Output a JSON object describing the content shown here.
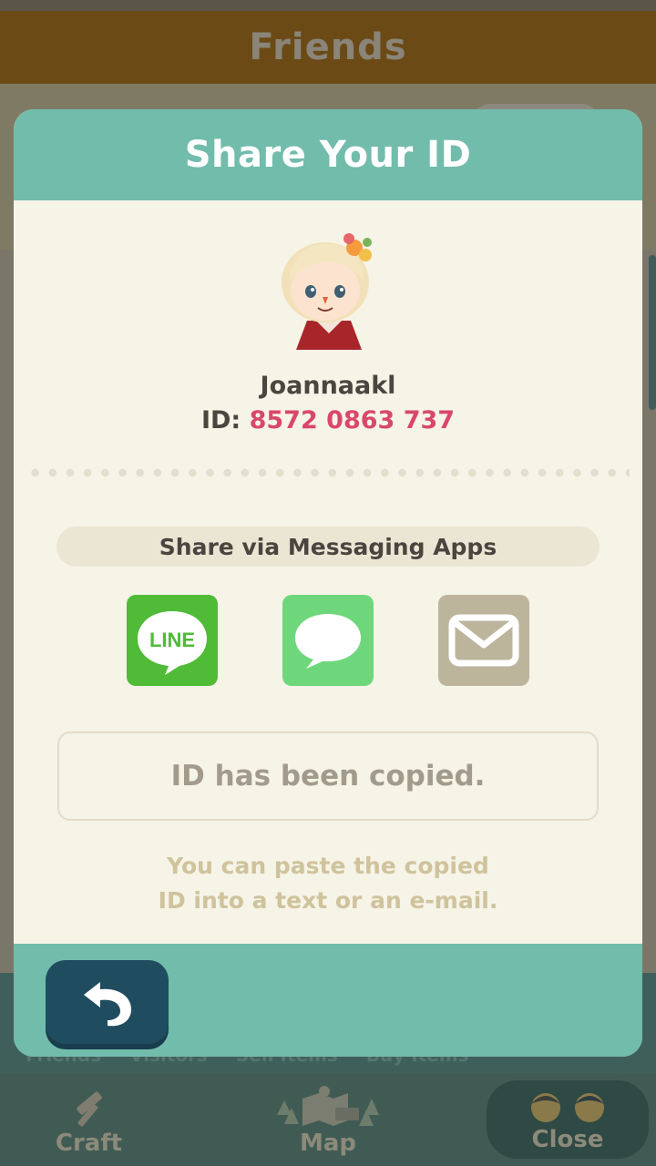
{
  "background": {
    "title": "Friends",
    "tab_labels": [
      "Friends",
      "Visitors",
      "Sell Items",
      "Buy Items"
    ]
  },
  "bottom_nav": {
    "items": [
      {
        "label": "Craft",
        "icon": "hammer-icon"
      },
      {
        "label": "Map",
        "icon": "map-icon"
      },
      {
        "label": "Close",
        "icon": "friends-faces-icon"
      }
    ]
  },
  "modal": {
    "title": "Share Your ID",
    "avatar": "player-avatar",
    "username": "Joannaakl",
    "id_label": "ID:",
    "id_value": "8572 0863 737",
    "share_heading": "Share via Messaging Apps",
    "share_apps": [
      {
        "label": "LINE",
        "icon": "line-icon",
        "color": "#4fbb37"
      },
      {
        "label": "",
        "icon": "speech-bubble-icon",
        "color": "#6fd77b"
      },
      {
        "label": "",
        "icon": "mail-icon",
        "color": "#bcb59c"
      }
    ],
    "copied_message": "ID has been copied.",
    "hint_line1": "You can paste the copied",
    "hint_line2": "ID into a text or an e-mail.",
    "back_icon": "back-arrow-icon"
  },
  "colors": {
    "header": "#72bcac",
    "panel": "#f6f3e7",
    "id_accent": "#d9476a",
    "back_button": "#1f4d5f"
  }
}
